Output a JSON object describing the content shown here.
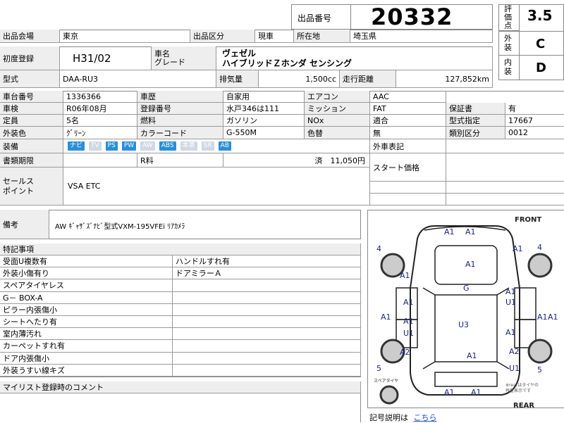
{
  "header": {
    "lot_label": "出品番号",
    "lot_number": "20332",
    "score_label": "評価点",
    "score_value": "3.5",
    "exterior_label": "外装",
    "exterior_value": "C",
    "interior_label": "内装",
    "interior_value": "D"
  },
  "row1": {
    "venue_label": "出品会場",
    "venue_value": "東京",
    "category_label": "出品区分",
    "category_value": "現車",
    "location_label": "所在地",
    "location_value": "埼玉県"
  },
  "vehicle": {
    "first_reg_label": "初度登録",
    "first_reg_value": "H31/02",
    "name_label": "車名\nグレード",
    "name_line1": "ヴェゼル",
    "name_line2": "ハイブリッドＺホンダ センシング",
    "model_label": "型式",
    "model_value": "DAA-RU3",
    "displacement_label": "排気量",
    "displacement_value": "1,500cc",
    "mileage_label": "走行距離",
    "mileage_value": "127,852km"
  },
  "details": {
    "chassis_label": "車台番号",
    "chassis_value": "1336366",
    "history_label": "車歴",
    "history_value": "自家用",
    "ac_label": "エアコン",
    "ac_value": "AAC",
    "inspection_label": "車検",
    "inspection_value": "R06年08月",
    "plate_label": "登録番号",
    "plate_value": "水戸346は111",
    "mission_label": "ミッション",
    "mission_value": "FAT",
    "warranty_label": "保証書",
    "warranty_value": "有",
    "capacity_label": "定員",
    "capacity_value": "5名",
    "fuel_label": "燃料",
    "fuel_value": "ガソリン",
    "nox_label": "NOx",
    "nox_value": "適合",
    "type_spec_label": "型式指定",
    "type_spec_value": "17667",
    "color_label": "外装色",
    "color_value": "ｸﾞﾘｰﾝ",
    "color_code_label": "カラーコード",
    "color_code_value": "G-550M",
    "repaint_label": "色替",
    "repaint_value": "無",
    "class_label": "類別区分",
    "class_value": "0012"
  },
  "equipment": {
    "label": "装備",
    "badges": [
      {
        "text": "ナビ",
        "active": true
      },
      {
        "text": "TV",
        "active": false
      },
      {
        "text": "PS",
        "active": true
      },
      {
        "text": "PW",
        "active": true
      },
      {
        "text": "AW",
        "active": false
      },
      {
        "text": "ABS",
        "active": true
      },
      {
        "text": "本革",
        "active": false
      },
      {
        "text": "SR",
        "active": false
      },
      {
        "text": "AB",
        "active": true
      }
    ],
    "odometer_display_label": "外車表記"
  },
  "documents": {
    "expiry_label": "書類期限",
    "rfee_label": "R料",
    "rfee_value": "済　11,050円",
    "start_price_label": "スタート価格"
  },
  "sales": {
    "label": "セールス\nポイント",
    "value": "VSA ETC"
  },
  "remarks": {
    "label": "備考",
    "value": "AW ｷﾞｬｻﾞｽﾞﾅﾋﾞ型式VXM-195VFEi ﾘｱｶﾒﾗ"
  },
  "special": {
    "title": "特記事項",
    "rows": [
      [
        "受面U複数有",
        "ハンドルすれ有"
      ],
      [
        "外装小傷有り",
        "ドアミラーＡ"
      ],
      [
        "スペアタイヤレス",
        ""
      ],
      [
        "G－ BOX-A",
        ""
      ],
      [
        "ピラー内張傷小",
        ""
      ],
      [
        "シートへたり有",
        ""
      ],
      [
        "室内薄汚れ",
        ""
      ],
      [
        "カーペットすれ有",
        ""
      ],
      [
        "ドア内張傷小",
        ""
      ],
      [
        "外装うすい線キズ",
        ""
      ]
    ]
  },
  "mylist": {
    "title": "マイリスト登録時のコメント"
  },
  "diagram": {
    "front": "FRONT",
    "rear": "REAR",
    "spare": "スペアタイヤ",
    "note": "※rearはタイヤの\n残量表示です",
    "marks": [
      "A1",
      "A1",
      "A1",
      "A1",
      "A1",
      "A1",
      "G",
      "A1",
      "U1",
      "A1",
      "A1",
      "U1",
      "A1",
      "U3",
      "A1",
      "A1",
      "A2",
      "A1",
      "U1",
      "A2",
      "A1",
      "A1"
    ],
    "numbers": [
      "4",
      "4",
      "5",
      "5"
    ],
    "explain_label": "記号説明は",
    "explain_link": "こちら"
  }
}
